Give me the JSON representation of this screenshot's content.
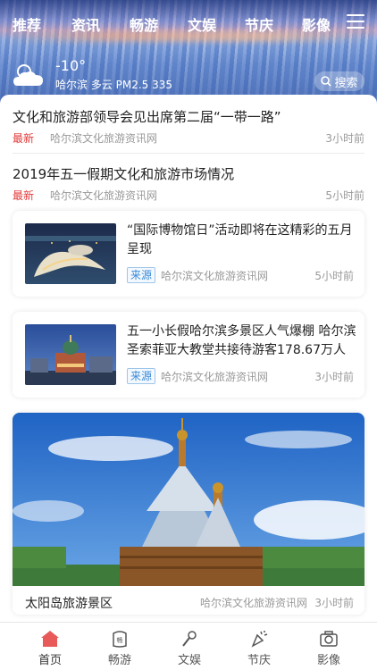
{
  "nav": {
    "items": [
      "推荐",
      "资讯",
      "畅游",
      "文娱",
      "节庆",
      "影像"
    ],
    "menu_icon": "hamburger-icon"
  },
  "weather": {
    "temperature": "-10°",
    "line": "哈尔滨 多云 PM2.5 335",
    "icon": "partly-cloudy-icon"
  },
  "search": {
    "label": "搜索",
    "icon": "search-icon"
  },
  "news": [
    {
      "title": "文化和旅游部领导会见出席第二届“一带一路”",
      "tag": "最新",
      "source": "哈尔滨文化旅游资讯网",
      "time": "3小时前"
    },
    {
      "title": "2019年五一假期文化和旅游市场情况",
      "tag": "最新",
      "source": "哈尔滨文化旅游资讯网",
      "time": "5小时前"
    }
  ],
  "cards": [
    {
      "title": "“国际博物馆日”活动即将在这精彩的五月呈现",
      "label": "来源",
      "source": "哈尔滨文化旅游资讯网",
      "time": "5小时前"
    },
    {
      "title": "五一小长假哈尔滨多景区人气爆棚 哈尔滨圣索菲亚大教堂共接待游客178.67万人",
      "label": "来源",
      "source": "哈尔滨文化旅游资讯网",
      "time": "3小时前"
    }
  ],
  "feature": {
    "title": "太阳岛旅游景区",
    "source": "哈尔滨文化旅游资讯网",
    "time": "3小时前"
  },
  "tabbar": [
    {
      "label": "首页",
      "icon": "home-icon"
    },
    {
      "label": "畅游",
      "icon": "travel-icon"
    },
    {
      "label": "文娱",
      "icon": "microphone-icon"
    },
    {
      "label": "节庆",
      "icon": "party-popper-icon"
    },
    {
      "label": "影像",
      "icon": "camera-icon"
    }
  ],
  "colors": {
    "accent_red": "#e23a3a",
    "source_blue": "#3a8ad8",
    "tab_active": "#e85a5a"
  }
}
